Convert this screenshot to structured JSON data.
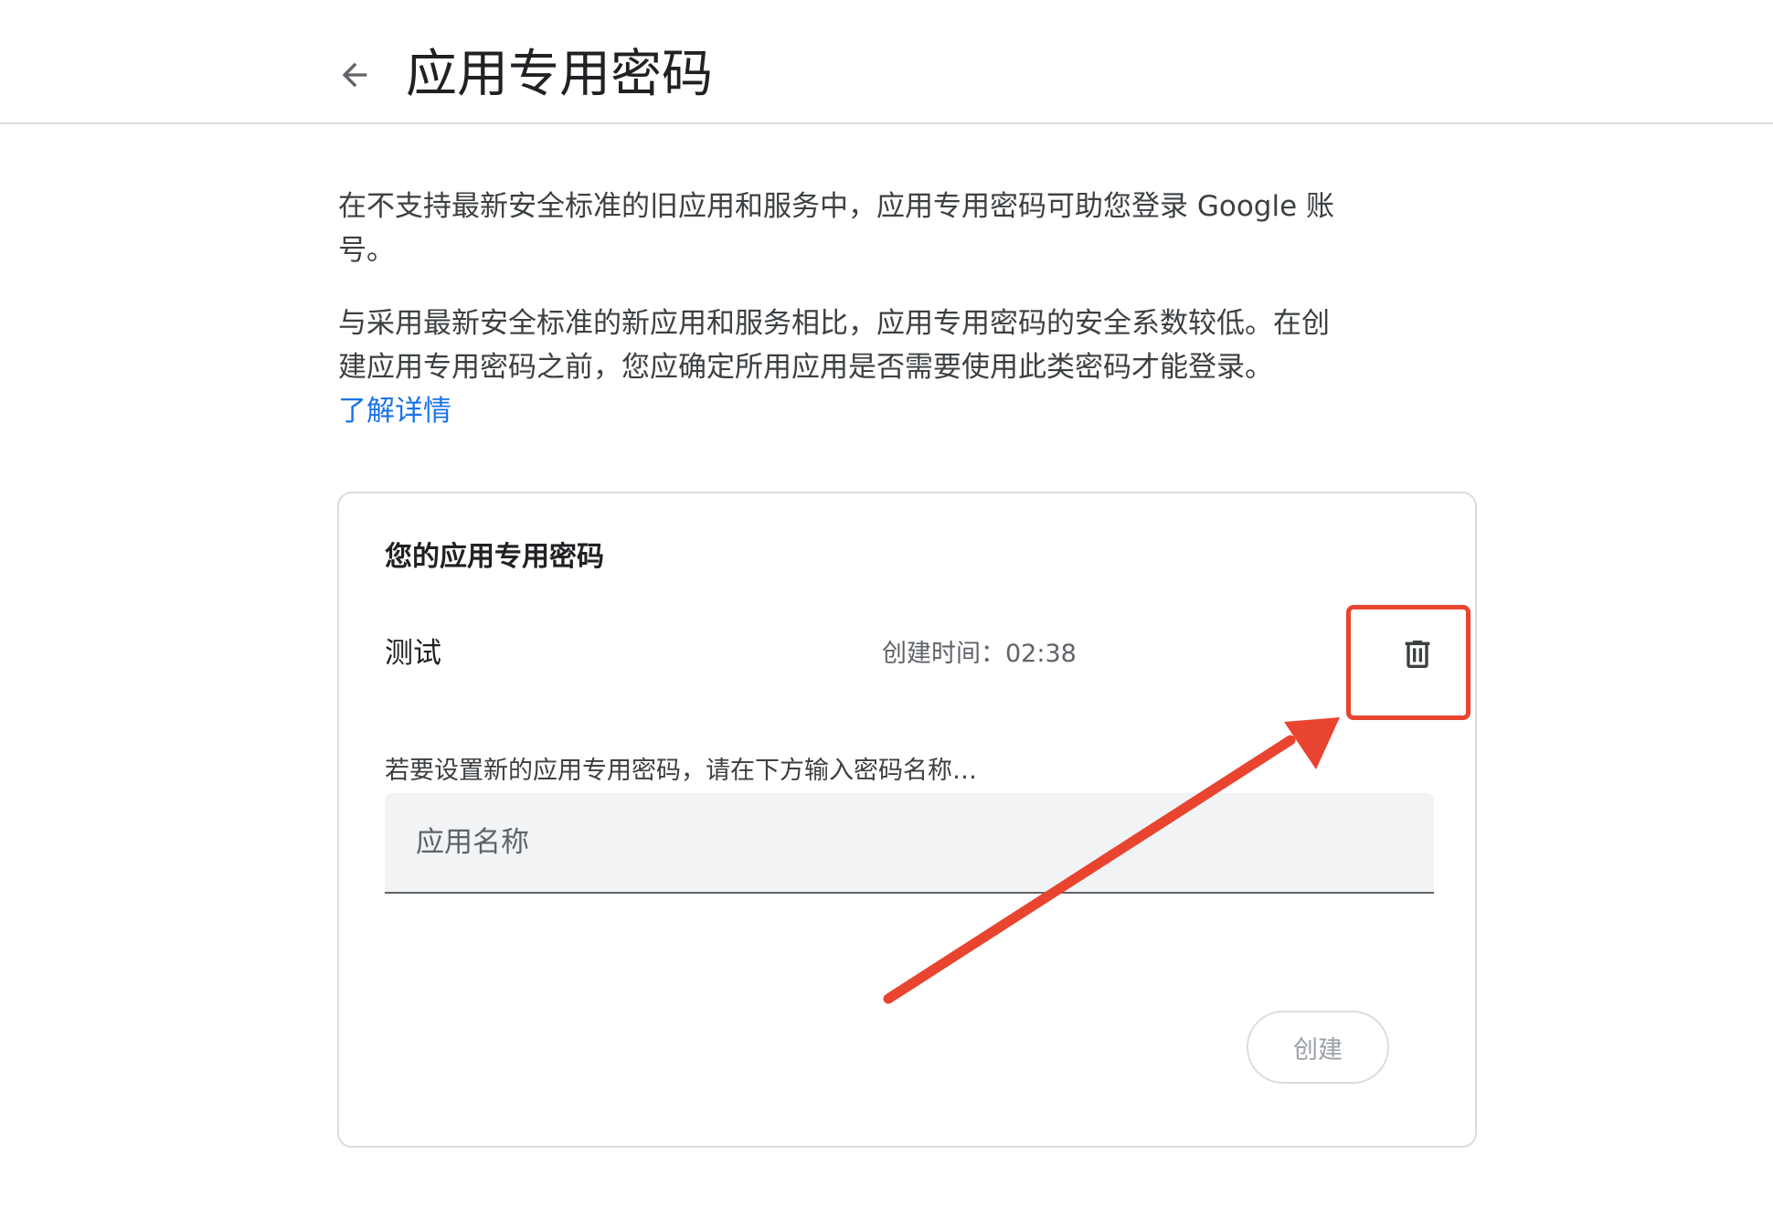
{
  "header": {
    "title": "应用专用密码",
    "back_icon": "arrow-back-icon"
  },
  "intro": {
    "line1": "在不支持最新安全标准的旧应用和服务中，应用专用密码可助您登录 Google 账号。",
    "line2": "与采用最新安全标准的新应用和服务相比，应用专用密码的安全系数较低。在创建应用专用密码之前，您应确定所用应用是否需要使用此类密码才能登录。",
    "learn_more": "了解详情"
  },
  "card": {
    "title": "您的应用专用密码",
    "passwords": [
      {
        "name": "测试",
        "created": "创建时间：02:38",
        "delete_icon": "trash-icon"
      }
    ],
    "helper_text": "若要设置新的应用专用密码，请在下方输入密码名称…",
    "input": {
      "placeholder": "应用名称",
      "value": ""
    },
    "create_label": "创建"
  },
  "colors": {
    "annotation": "#e8442f",
    "link": "#1a73e8",
    "text_primary": "#202124",
    "text_secondary": "#5f6368",
    "border": "#dadce0",
    "input_bg": "#f1f3f4"
  }
}
